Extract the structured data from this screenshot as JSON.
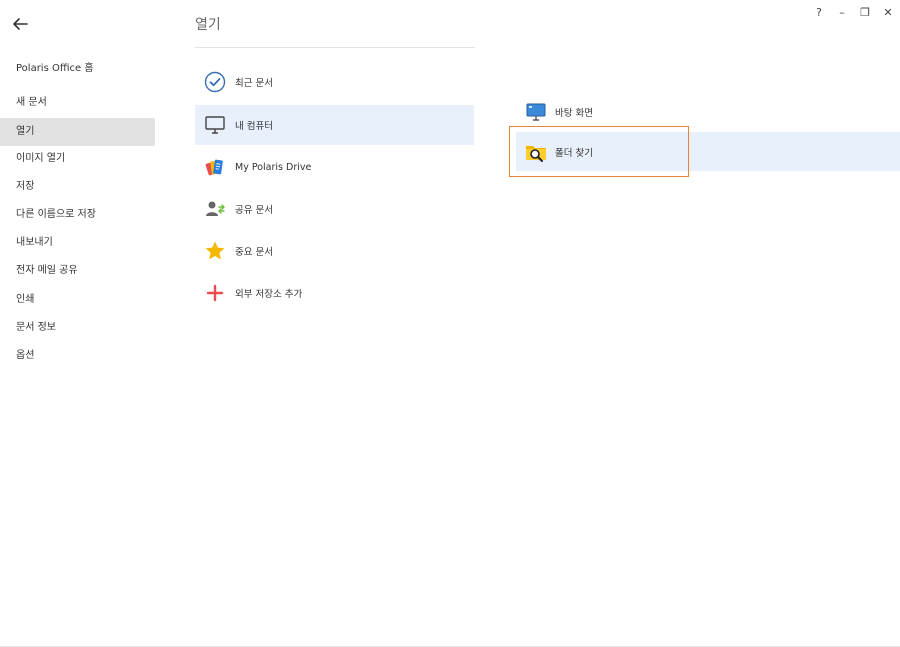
{
  "window": {
    "help_label": "?",
    "minimize_label": "–",
    "restore_label": "❐",
    "close_label": "✕"
  },
  "nav": {
    "items": [
      {
        "label": "Polaris Office 홈"
      },
      {
        "label": "새 문서"
      },
      {
        "label": "열기",
        "active": true
      },
      {
        "label": "이미지 열기"
      },
      {
        "label": "저장"
      },
      {
        "label": "다른 이름으로 저장"
      },
      {
        "label": "내보내기"
      },
      {
        "label": "전자 메일 공유"
      },
      {
        "label": "인쇄"
      },
      {
        "label": "문서 정보"
      },
      {
        "label": "옵션"
      }
    ]
  },
  "main": {
    "title": "열기",
    "locations": [
      {
        "label": "최근 문서",
        "icon": "check-circle-icon"
      },
      {
        "label": "내 컴퓨터",
        "icon": "monitor-icon",
        "active": true
      },
      {
        "label": "My Polaris Drive",
        "icon": "polaris-drive-icon"
      },
      {
        "label": "공유 문서",
        "icon": "shared-user-icon"
      },
      {
        "label": "중요 문서",
        "icon": "star-icon"
      },
      {
        "label": "외부 저장소 추가",
        "icon": "plus-icon"
      }
    ]
  },
  "computer": {
    "items": [
      {
        "label": "바탕 화면",
        "icon": "desktop-monitor-icon"
      },
      {
        "label": "폴더 찾기",
        "icon": "folder-search-icon",
        "active": true
      }
    ]
  },
  "colors": {
    "accent_orange": "#e8843a",
    "active_blue": "#e8f0fb",
    "nav_active": "#e2e2e2",
    "star": "#f5b800",
    "plus": "#e84e4e",
    "check": "#3a6fb8"
  }
}
